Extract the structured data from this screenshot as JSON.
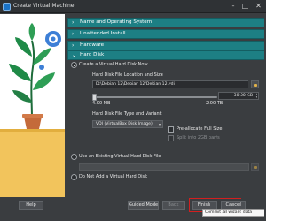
{
  "window": {
    "title": "Create Virtual Machine"
  },
  "sections": [
    {
      "label": "Name and Operating System",
      "expanded": false
    },
    {
      "label": "Unattended Install",
      "expanded": false
    },
    {
      "label": "Hardware",
      "expanded": false
    },
    {
      "label": "Hard Disk",
      "expanded": true
    }
  ],
  "hard_disk": {
    "option_create": "Create a Virtual Hard Disk Now",
    "location_label": "Hard Disk File Location and Size",
    "location_value": "D:\\Debian 12\\Debian 12\\Debian 12.vdi",
    "size_value": "30.00 GB",
    "size_min": "4.00 MB",
    "size_max": "2.00 TB",
    "size_fraction": 0.015,
    "type_label": "Hard Disk File Type and Variant",
    "type_value": "VDI (VirtualBox Disk Image)",
    "preallocate_label": "Pre-allocate Full Size",
    "split_label": "Split into 2GB parts",
    "option_existing": "Use an Existing Virtual Hard Disk File",
    "option_none": "Do Not Add a Virtual Hard Disk"
  },
  "buttons": {
    "help": "Help",
    "guided_mode": "Guided Mode",
    "back": "Back",
    "finish": "Finish",
    "cancel": "Cancel"
  },
  "tooltip": "Commit all wizard data",
  "colors": {
    "section_header": "#1d7f84",
    "window_bg": "#3a3d40",
    "highlight": "#d11f1f"
  }
}
